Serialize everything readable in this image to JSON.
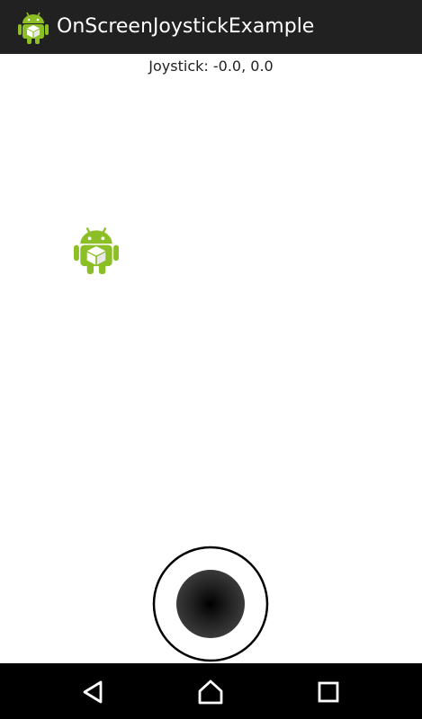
{
  "app_bar": {
    "title": "OnScreenJoystickExample",
    "icon": "android-cube-icon",
    "background": "#212121"
  },
  "content": {
    "joystick_readout": "Joystick: -0.0, 0.0",
    "sprite_icon": "android-cube-icon",
    "joystick": {
      "x": -0.0,
      "y": 0.0
    }
  },
  "nav_bar": {
    "buttons": [
      {
        "icon": "back-triangle-icon"
      },
      {
        "icon": "home-icon"
      },
      {
        "icon": "recents-square-icon"
      }
    ],
    "background": "#000000"
  },
  "colors": {
    "android_green": "#8CBF26",
    "joystick_knob": "#333333"
  }
}
